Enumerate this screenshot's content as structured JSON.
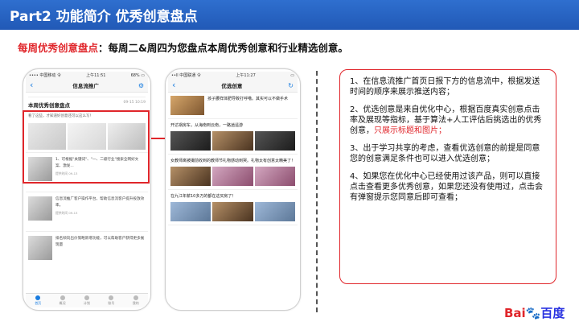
{
  "header": {
    "title": "Part2 功能简介 优秀创意盘点"
  },
  "subtitle": {
    "highlight": "每周优秀创意盘点",
    "text": "：每周二&周四为您盘点本周优秀创意和行业精选创意。"
  },
  "left_phone": {
    "status_left": "•••• 中国移动 令",
    "status_time": "上午11:51",
    "status_right": "68% ▭",
    "nav_back": "‹",
    "nav_title": "信息流推广",
    "card_title": "本周优秀创意盘点",
    "card_date": "09-15 10:19",
    "card_desc": "看了这些，才知道好创意还可以这么写！",
    "news": [
      {
        "text": "1、可根据\"关键词\"、\"一、二级行业\"搜索全网好文案、激发...",
        "meta": "提供时间 09-13"
      },
      {
        "text": "信息流推广客户操作平台，帮助信息流客户提升投放效率。",
        "meta": "提供时间 09-13"
      },
      {
        "text": "排名倾向出价策略新增功能，可以帮助客户获得更多展现量",
        "meta": ""
      }
    ],
    "tabs": [
      "首页",
      "概况",
      "计划",
      "账号",
      "我的"
    ]
  },
  "right_phone": {
    "status_left": "••ll 中国联通 令",
    "status_time": "上午11:27",
    "status_right": "▭",
    "nav_back": "‹",
    "nav_title": "优选创意",
    "items": [
      {
        "text": "孩子腰样体肥导致打呼噜。其实可以不做手术"
      },
      {
        "text": "开达祸房车，从海南到云南，一路逍遥游"
      },
      {
        "text": "女教师离被撮前收到的教师节礼物感动到哭。礼物太有创意太精美了！"
      },
      {
        "text": "在九江年薪10多万的都在这买房了！"
      }
    ]
  },
  "notes": [
    {
      "text": "1、在信息流推广首页日报下方的信息流中，根据发送时间的顺序来展示推送内容；",
      "red": ""
    },
    {
      "text": "2、优选创意是来自优化中心，根据百度真实创意点击率及展现等指标，基于算法+人工评估后挑选出的优秀创意，",
      "red": "只展示标题和图片；"
    },
    {
      "text": "3、出于学习共享的考虑，查看优选创意的前提是同意您的创意满足条件也可以进入优选创意；",
      "red": ""
    },
    {
      "text": "4、如果您在优化中心已经使用过该产品，则可以直接点击查看更多优秀创意，如果您还没有使用过，点击会有弹窗提示您同意后即可查看；",
      "red": ""
    }
  ],
  "logo": {
    "part1": "Bai",
    "paw": "🐾",
    "part2": "百度"
  },
  "colors": {
    "header_blue": "#2159b6",
    "accent_red": "#e0262b",
    "link_blue": "#1a7de0"
  }
}
